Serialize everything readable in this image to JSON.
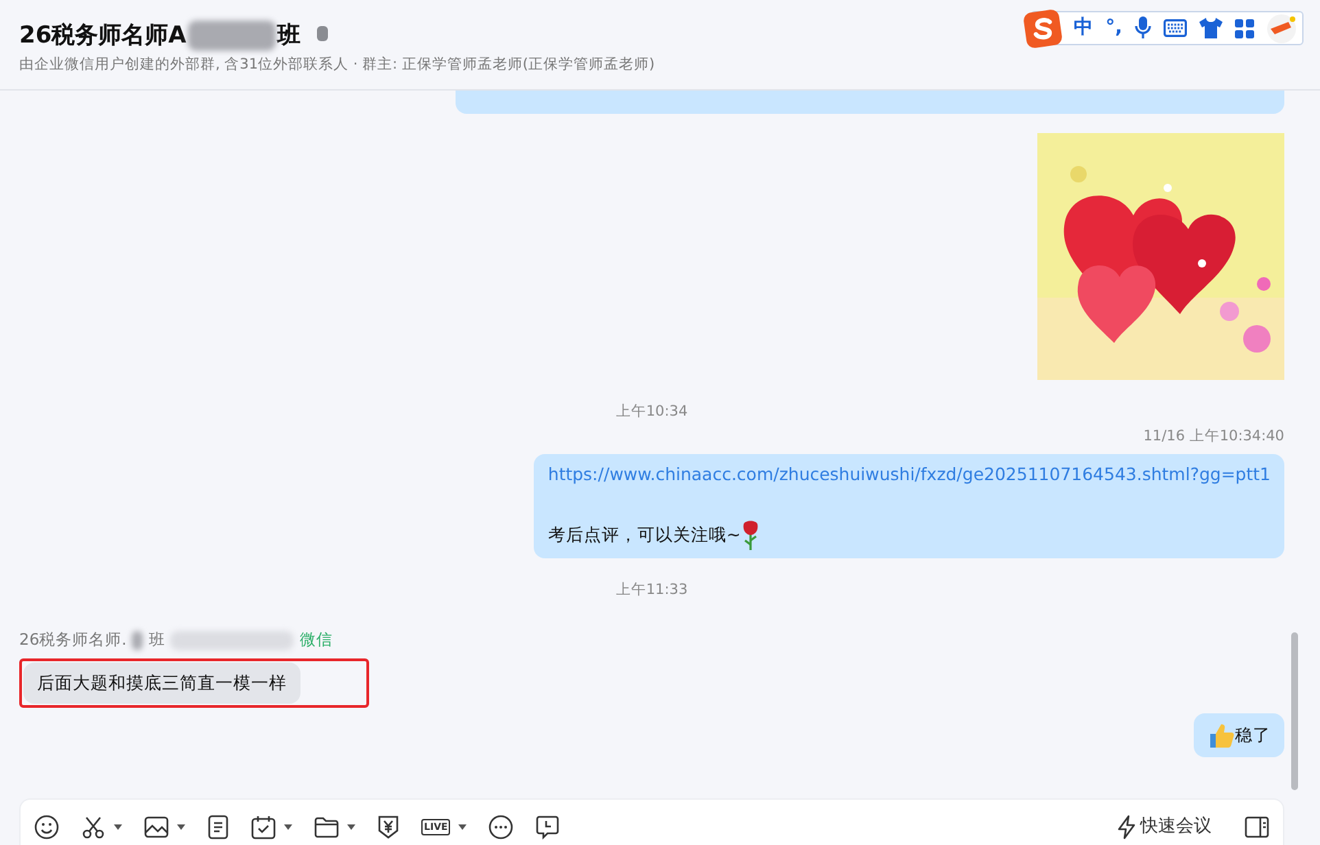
{
  "header": {
    "title_start": "26税务师名师A",
    "title_end": "班",
    "subtitle": "由企业微信用户创建的外部群, 含31位外部联系人 · 群主: 正保学管师孟老师(正保学管师孟老师)"
  },
  "ime": {
    "mode": "中",
    "punct": "°,"
  },
  "messages": [
    {
      "kind": "cut_bubble",
      "outgoing": true
    },
    {
      "kind": "picture",
      "outgoing": true
    },
    {
      "kind": "time",
      "text": "上午10:34"
    },
    {
      "kind": "stamp",
      "text": "11/16 上午10:34:40"
    },
    {
      "kind": "text",
      "outgoing": true,
      "link": "https://www.chinaacc.com/zhuceshuiwushi/fxzd/ge20251107164543.shtml?gg=ptt1",
      "text": "考后点评，可以关注哦~",
      "rose_icon": true
    },
    {
      "kind": "time",
      "text": "上午11:33"
    },
    {
      "kind": "sender",
      "name_start": "26税务师名师.",
      "name_end": "班",
      "source": "微信"
    },
    {
      "kind": "text",
      "outgoing": false,
      "highlighted": true,
      "text": "后面大题和摸底三简直一模一样"
    },
    {
      "kind": "text",
      "outgoing": true,
      "thumbs_up_icon": true,
      "text": "稳了"
    }
  ],
  "toolbar": {
    "live_label": "LIVE",
    "meeting": "快速会议"
  }
}
